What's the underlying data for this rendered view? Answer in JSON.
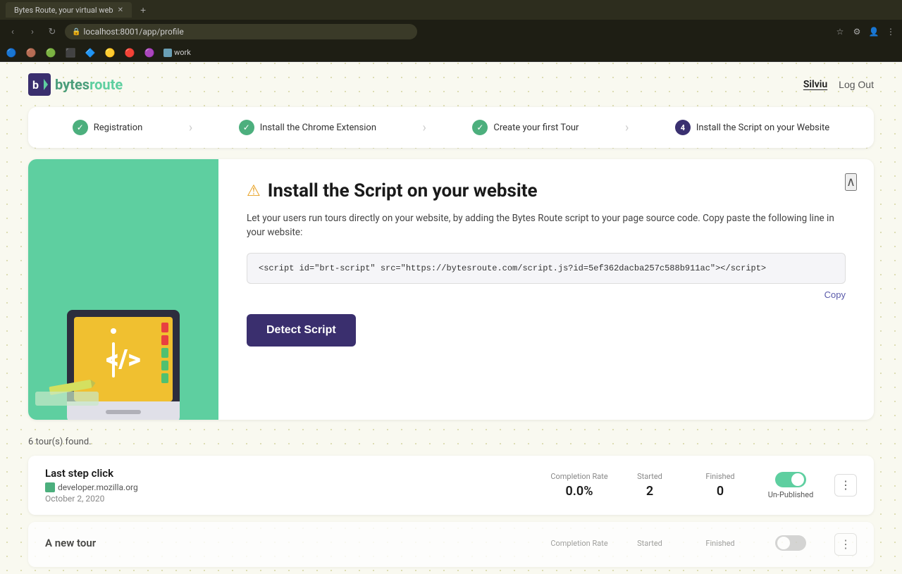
{
  "browser": {
    "tab_title": "Bytes Route, your virtual web",
    "address": "localhost:8001/app/profile",
    "bookmarks": [
      "work"
    ]
  },
  "header": {
    "logo_name_part1": "bytes",
    "logo_name_part2": "route",
    "user": "Silviu",
    "logout_label": "Log Out"
  },
  "steps": [
    {
      "id": 1,
      "label": "Registration",
      "status": "completed",
      "icon": "✓"
    },
    {
      "id": 2,
      "label": "Install the Chrome Extension",
      "status": "completed",
      "icon": "✓"
    },
    {
      "id": 3,
      "label": "Create your first Tour",
      "status": "completed",
      "icon": "✓"
    },
    {
      "id": 4,
      "label": "Install the Script on your Website",
      "status": "active",
      "icon": "4"
    }
  ],
  "install_card": {
    "title": "Install the Script on your website",
    "description": "Let your users run tours directly on your website, by adding the Bytes Route script to your page source code. Copy paste the following line in your website:",
    "script_code": "<script id=\"brt-script\" src=\"https://bytesroute.com/script.js?id=5ef362dacba257c588b911ac\"></script>",
    "copy_label": "Copy",
    "detect_button": "Detect Script"
  },
  "tours": {
    "count_label": "6 tour(s) found.",
    "items": [
      {
        "name": "Last step click",
        "site": "developer.mozilla.org",
        "date": "October 2, 2020",
        "completion_rate_label": "Completion Rate",
        "completion_rate": "0.0%",
        "started_label": "Started",
        "started": "2",
        "finished_label": "Finished",
        "finished": "0",
        "toggle_state": "on",
        "status_label": "Un-Published"
      },
      {
        "name": "A new tour",
        "site": "",
        "date": "",
        "completion_rate_label": "Completion Rate",
        "completion_rate": "",
        "started_label": "Started",
        "started": "",
        "finished_label": "Finished",
        "finished": "",
        "toggle_state": "off",
        "status_label": ""
      }
    ]
  }
}
